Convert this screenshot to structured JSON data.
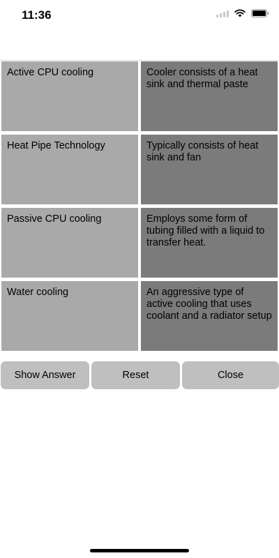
{
  "status_bar": {
    "time": "11:36"
  },
  "matching": {
    "rows": [
      {
        "term": "Active CPU cooling",
        "definition": "Cooler consists of a heat sink and thermal paste"
      },
      {
        "term": "Heat Pipe Technology",
        "definition": "Typically consists of heat sink and fan"
      },
      {
        "term": "Passive CPU cooling",
        "definition": "Employs some form of tubing filled with a liquid to transfer heat."
      },
      {
        "term": "Water cooling",
        "definition": "An aggressive type of active cooling that uses coolant and  a radiator setup"
      }
    ]
  },
  "buttons": {
    "show_answer": "Show Answer",
    "reset": "Reset",
    "close": "Close"
  },
  "colors": {
    "term_cell": "#a9a9a9",
    "definition_cell": "#7b7b7b",
    "button": "#bfbfbf"
  }
}
